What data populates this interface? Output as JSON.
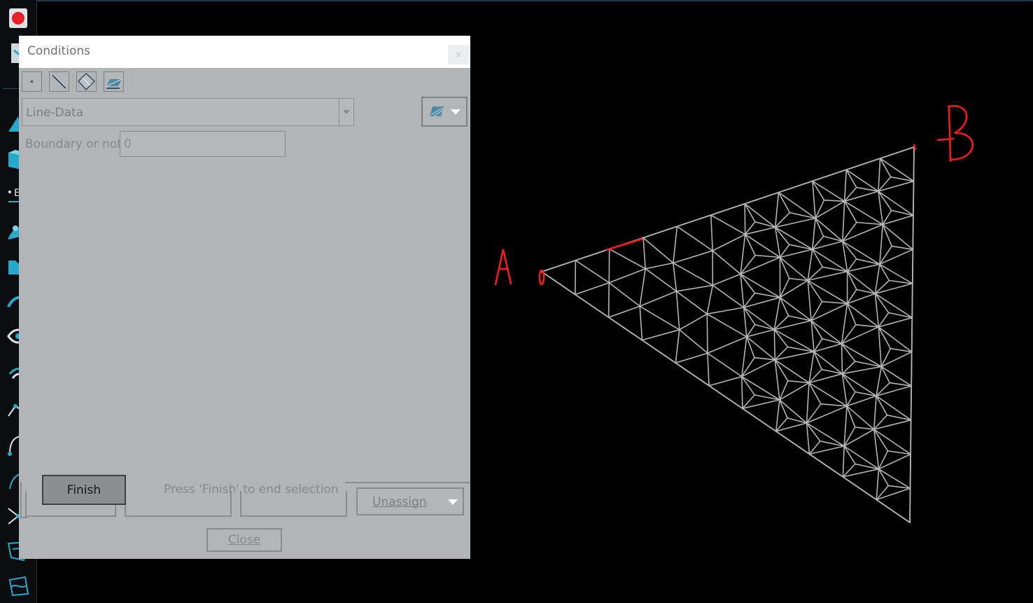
{
  "dialog": {
    "title": "Conditions",
    "close_glyph": "×",
    "entity_buttons": [
      "point-icon",
      "line-icon",
      "surface-icon",
      "volume-icon"
    ],
    "condition_select": {
      "value": "Line-Data"
    },
    "layer_button_icon": "layer-surface-icon",
    "boundary_field": {
      "label": "Boundary or not",
      "value": "0"
    },
    "finish_button": "Finish",
    "finish_hint": "Press 'Finish' to end selection",
    "unassign_button": "Unassign",
    "close_button": "Close"
  },
  "viewport": {
    "annotations": {
      "point_a": "A",
      "point_b": "B"
    },
    "annotation_color": "#ff1a1a",
    "mesh_color": "#b4b4b4"
  },
  "colors": {
    "background": "#000000",
    "dialog_body": "#b2b5b8",
    "toolbar_accent": "#27a9c9",
    "record_red": "#e8202a"
  }
}
